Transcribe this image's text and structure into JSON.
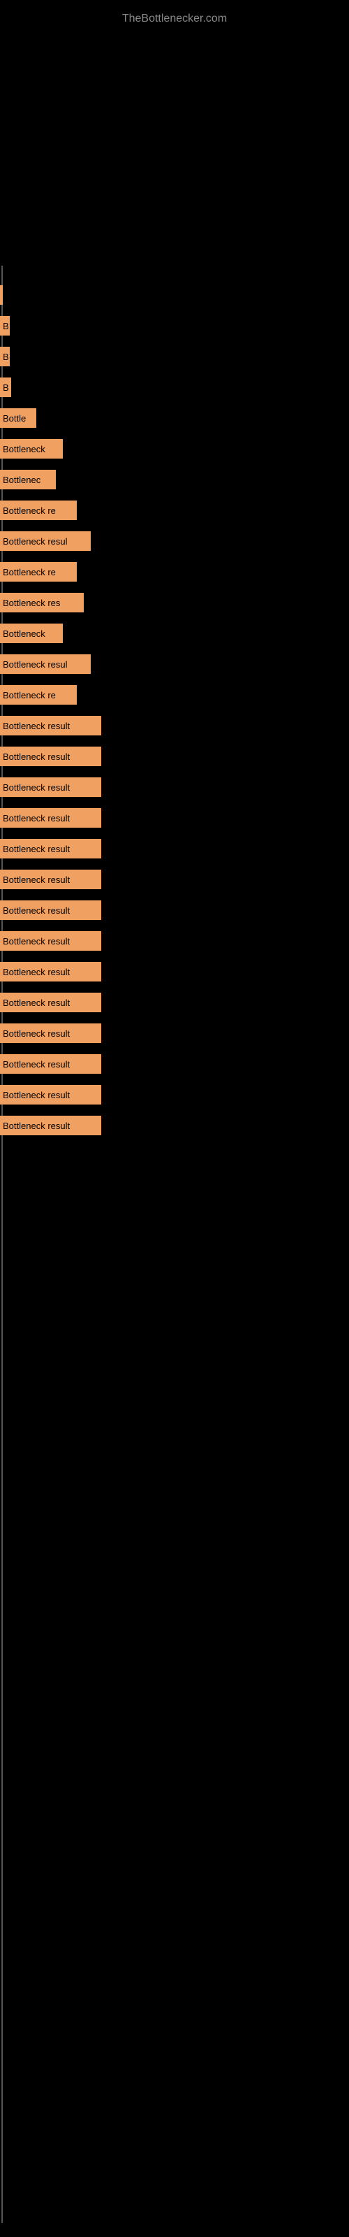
{
  "site": {
    "title": "TheBottlenecker.com"
  },
  "bars": [
    {
      "label": "",
      "width": 2
    },
    {
      "label": "B",
      "width": 14
    },
    {
      "label": "B",
      "width": 14
    },
    {
      "label": "B",
      "width": 16
    },
    {
      "label": "Bottle",
      "width": 52
    },
    {
      "label": "Bottleneck",
      "width": 90
    },
    {
      "label": "Bottlenec",
      "width": 80
    },
    {
      "label": "Bottleneck re",
      "width": 110
    },
    {
      "label": "Bottleneck resul",
      "width": 130
    },
    {
      "label": "Bottleneck re",
      "width": 110
    },
    {
      "label": "Bottleneck res",
      "width": 120
    },
    {
      "label": "Bottleneck",
      "width": 90
    },
    {
      "label": "Bottleneck resul",
      "width": 130
    },
    {
      "label": "Bottleneck re",
      "width": 110
    },
    {
      "label": "Bottleneck result",
      "width": 145
    },
    {
      "label": "Bottleneck result",
      "width": 145
    },
    {
      "label": "Bottleneck result",
      "width": 145
    },
    {
      "label": "Bottleneck result",
      "width": 145
    },
    {
      "label": "Bottleneck result",
      "width": 145
    },
    {
      "label": "Bottleneck result",
      "width": 145
    },
    {
      "label": "Bottleneck result",
      "width": 145
    },
    {
      "label": "Bottleneck result",
      "width": 145
    },
    {
      "label": "Bottleneck result",
      "width": 145
    },
    {
      "label": "Bottleneck result",
      "width": 145
    },
    {
      "label": "Bottleneck result",
      "width": 145
    },
    {
      "label": "Bottleneck result",
      "width": 145
    },
    {
      "label": "Bottleneck result",
      "width": 145
    },
    {
      "label": "Bottleneck result",
      "width": 145
    }
  ]
}
